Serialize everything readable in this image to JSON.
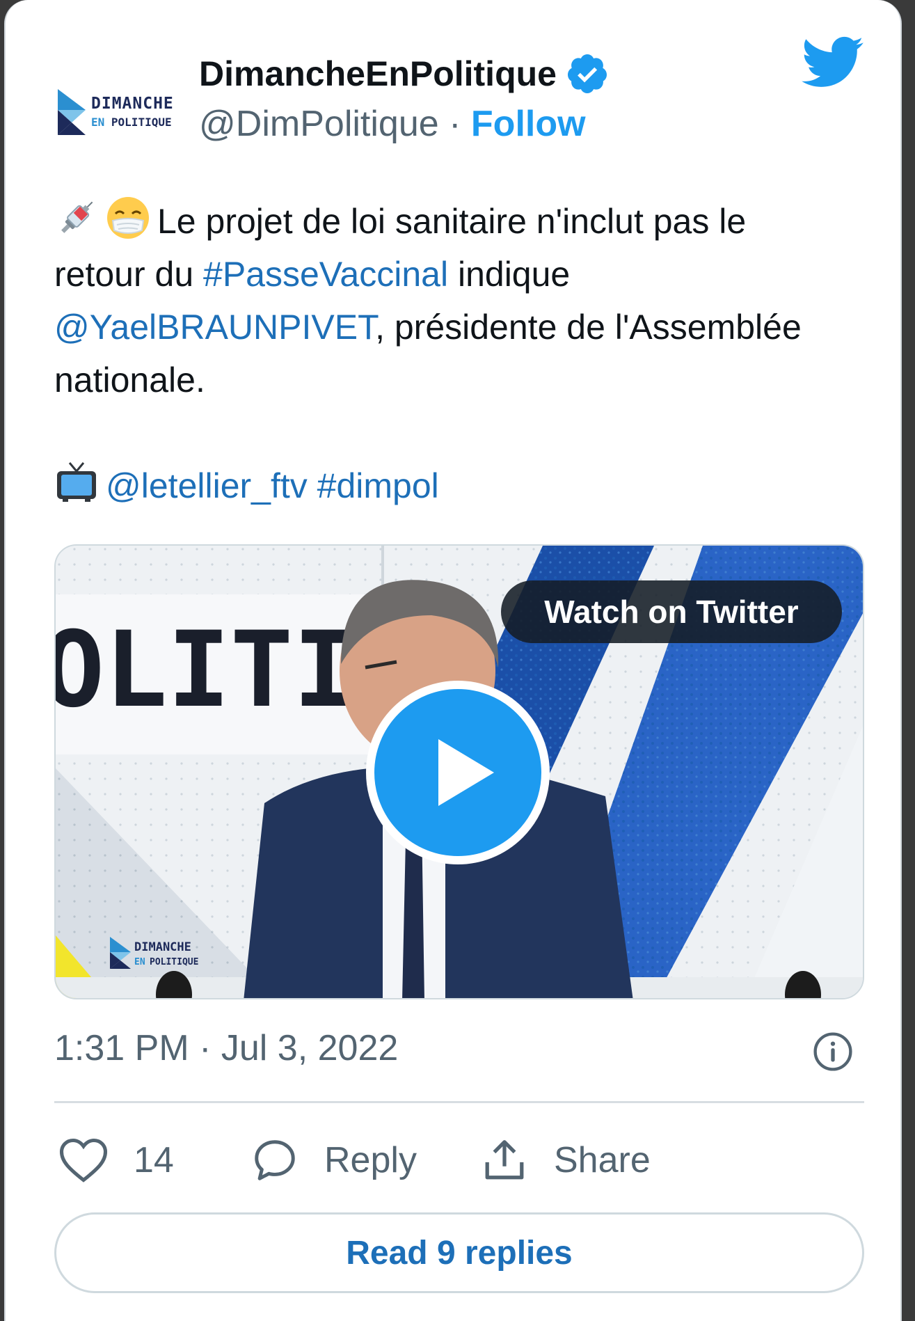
{
  "tweet": {
    "avatar": {
      "logo_line1": "DIMANCHE",
      "logo_line2_a": "EN",
      "logo_line2_b": "POLITIQUE"
    },
    "display_name": "DimancheEnPolitique",
    "handle": "@DimPolitique",
    "separator": "·",
    "follow_label": "Follow",
    "text": {
      "line1_text": "Le projet de loi sanitaire n'inclut pas le",
      "line2_prefix": "retour du ",
      "hashtag_passe": "#PasseVaccinal",
      "line2_suffix": " indique",
      "mention_yael": "@YaelBRAUNPIVET",
      "line3_suffix": ", présidente de l'Assemblée",
      "line4": "nationale.",
      "mention_letellier": "@letellier_ftv",
      "space": " ",
      "hashtag_dimpol": "#dimpol"
    },
    "media": {
      "watch_label": "Watch on Twitter",
      "backdrop_text": "OLITIQ",
      "logo_line1": "DIMANCHE",
      "logo_line2_a": "EN",
      "logo_line2_b": "POLITIQUE"
    },
    "timestamp": "1:31 PM · Jul 3, 2022",
    "actions": {
      "likes_count": "14",
      "reply_label": "Reply",
      "share_label": "Share"
    },
    "read_replies_label": "Read 9 replies"
  },
  "icons": {
    "verified": "verified-badge-icon",
    "twitter": "twitter-bird-icon",
    "syringe": "syringe-emoji-icon",
    "mask": "face-with-mask-emoji-icon",
    "tv": "television-emoji-icon",
    "play": "play-icon",
    "info": "info-icon",
    "like": "heart-icon",
    "reply": "speech-bubble-icon",
    "share": "share-upload-icon"
  },
  "colors": {
    "accent": "#1d9bf0",
    "link": "#1d6fb8",
    "text": "#0f1419",
    "secondary": "#536471"
  }
}
